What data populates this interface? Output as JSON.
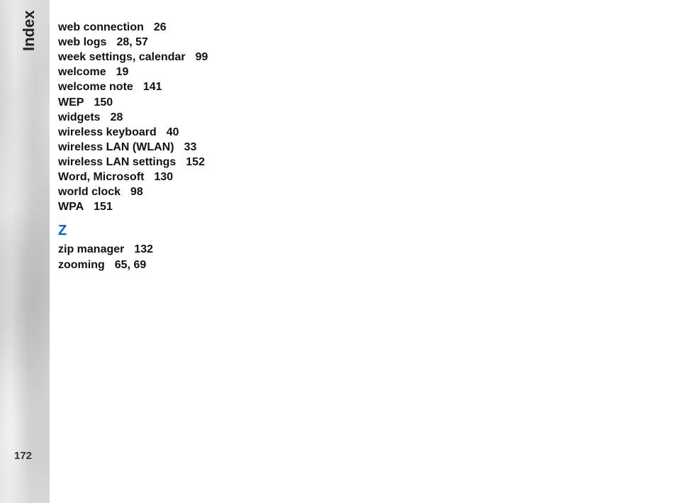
{
  "section_label": "Index",
  "page_number": "172",
  "entries_w": [
    {
      "term": "web connection",
      "pages": "26"
    },
    {
      "term": "web logs",
      "pages": "28, 57"
    },
    {
      "term": "week settings, calendar",
      "pages": "99"
    },
    {
      "term": "welcome",
      "pages": "19"
    },
    {
      "term": "welcome note",
      "pages": "141"
    },
    {
      "term": "WEP",
      "pages": "150"
    },
    {
      "term": "widgets",
      "pages": "28"
    },
    {
      "term": "wireless keyboard",
      "pages": "40"
    },
    {
      "term": "wireless LAN (WLAN)",
      "pages": "33"
    },
    {
      "term": "wireless LAN settings",
      "pages": "152"
    },
    {
      "term": "Word, Microsoft",
      "pages": "130"
    },
    {
      "term": "world clock",
      "pages": "98"
    },
    {
      "term": "WPA",
      "pages": "151"
    }
  ],
  "letter_z": "Z",
  "entries_z": [
    {
      "term": "zip manager",
      "pages": "132"
    },
    {
      "term": "zooming",
      "pages": "65, 69"
    }
  ]
}
